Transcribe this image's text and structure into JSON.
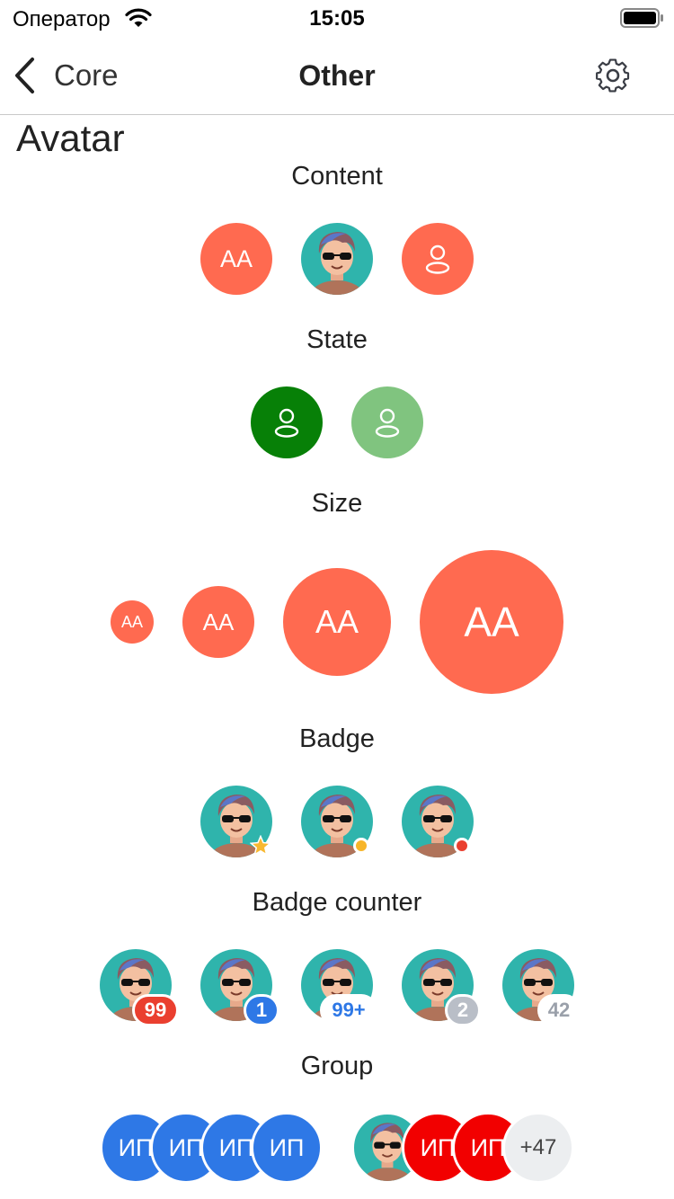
{
  "status_bar": {
    "carrier": "Оператор",
    "time": "15:05"
  },
  "nav": {
    "back_label": "Core",
    "title": "Other"
  },
  "page_title": "Avatar",
  "sections": {
    "content": "Content",
    "state": "State",
    "size": "Size",
    "badge": "Badge",
    "badge_counter": "Badge counter",
    "group": "Group"
  },
  "content_avatars": {
    "initials": "AA"
  },
  "size_avatars": [
    "AA",
    "AA",
    "AA",
    "AA"
  ],
  "badge_counters": [
    "99",
    "1",
    "99+",
    "2",
    "42"
  ],
  "groups": {
    "initials": [
      "ИП",
      "ИП",
      "ИП",
      "ИП"
    ],
    "mixed_initials": [
      "ИП",
      "ИП"
    ],
    "overflow": "+47"
  },
  "colors": {
    "coral": "#ff6a50",
    "green_dark": "#078007",
    "green_light": "#80c47f",
    "blue": "#2e78e6",
    "red": "#f20000",
    "star": "#f8b830",
    "dot_yellow": "#f7b529",
    "dot_red": "#ea3f2f"
  }
}
